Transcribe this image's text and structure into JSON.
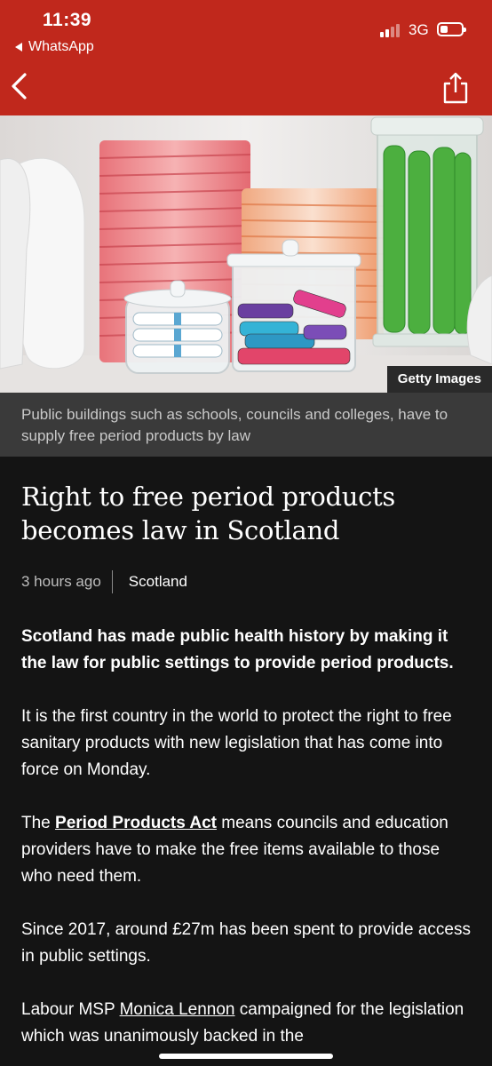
{
  "status_bar": {
    "time": "11:39",
    "back_app": "WhatsApp",
    "network": "3G"
  },
  "nav": {
    "back_icon": "chevron-left-icon",
    "share_icon": "share-icon",
    "bar_color": "#c0281c"
  },
  "hero": {
    "credit": "Getty Images",
    "caption": "Public buildings such as schools, councils and colleges, have to supply free period products by law"
  },
  "article": {
    "headline": "Right to free period products becomes law in Scotland",
    "time_ago": "3 hours ago",
    "topic": "Scotland",
    "lead": "Scotland has made public health history by making it the law for public settings to provide period products.",
    "p2": "It is the first country in the world to protect the right to free sanitary products with new legislation that has come into force on Monday.",
    "p3_start": "The ",
    "p3_link": "Period Products Act",
    "p3_end": " means councils and education providers have to make the free items available to those who need them.",
    "p4": "Since 2017, around £27m has been spent to provide access in public settings.",
    "p5_start": "Labour MSP ",
    "p5_link": "Monica Lennon",
    "p5_end": " campaigned for the legislation which was unanimously backed in the"
  }
}
